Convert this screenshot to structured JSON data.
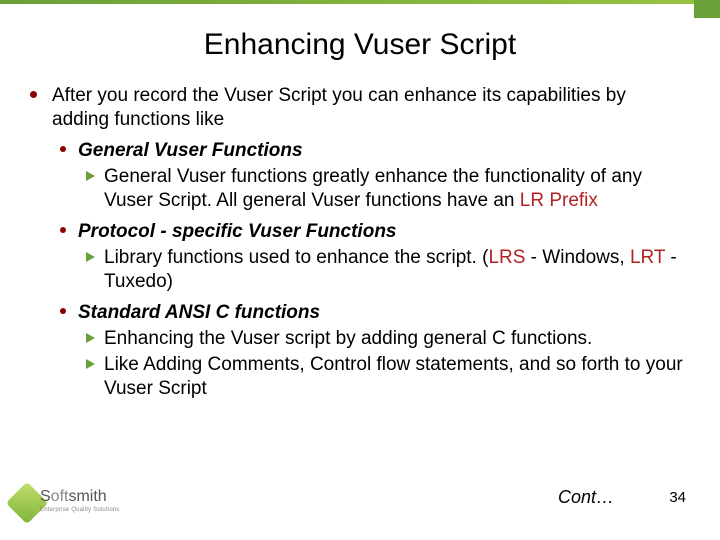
{
  "slide": {
    "title": "Enhancing Vuser Script",
    "intro": "After you record the Vuser Script you can enhance its capabilities by adding functions like",
    "sections": [
      {
        "heading": "General Vuser Functions",
        "items": [
          {
            "prefix": "General Vuser functions greatly enhance the functionality of any Vuser Script. All general Vuser functions have an ",
            "accent": "LR Prefix",
            "suffix": ""
          }
        ]
      },
      {
        "heading": "Protocol - specific Vuser Functions",
        "items": [
          {
            "prefix": "Library functions used to enhance the script. (",
            "accent": "LRS",
            "mid": " - Windows, ",
            "accent2": "LRT",
            "suffix": " - Tuxedo)"
          }
        ]
      },
      {
        "heading": "Standard ANSI C functions",
        "items": [
          {
            "prefix": "Enhancing the Vuser script by adding general C functions."
          },
          {
            "prefix": "Like Adding Comments, Control flow statements, and so forth to your Vuser Script"
          }
        ]
      }
    ],
    "continued": "Cont…",
    "page_number": "34"
  },
  "logo": {
    "name_part1": "S",
    "name_part2": "oft",
    "name_part3": "smith",
    "tagline": "Enterprise Quality Solutions"
  }
}
